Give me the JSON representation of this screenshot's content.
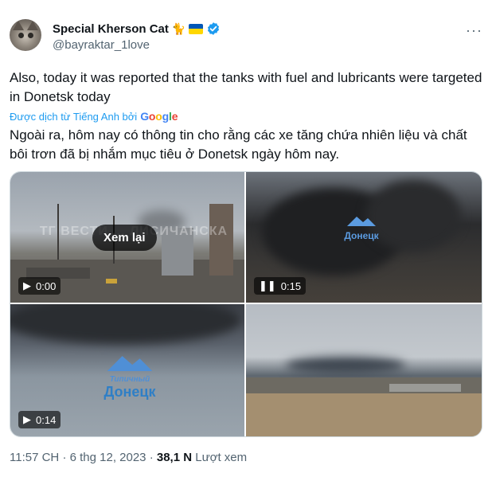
{
  "author": {
    "display_name": "Special Kherson Cat",
    "handle": "@bayraktar_1love",
    "cat_emoji": "🐈",
    "more_label": "···"
  },
  "tweet": {
    "text_original": "Also, today it was reported that the tanks with fuel and lubricants were targeted in Donetsk today",
    "translated_by_label": "Được dịch từ Tiếng Anh bởi",
    "google_label": "Google",
    "text_translated": "Ngoài ra, hôm nay có thông tin cho rằng các xe tăng chứa nhiên liệu và chất bôi trơn đã bị nhắm mục tiêu ở Donetsk ngày hôm nay."
  },
  "media": [
    {
      "type": "video",
      "state": "play",
      "time": "0:00",
      "overlay_button": "Xem lại",
      "watermark": "ТГ ВЕСТИ ... ЛИСИЧАНСКА"
    },
    {
      "type": "video",
      "state": "pause",
      "time": "0:15",
      "watermark": "Донецк"
    },
    {
      "type": "video",
      "state": "play",
      "time": "0:14",
      "watermark_top": "Типичный",
      "watermark": "Донецк"
    },
    {
      "type": "image"
    }
  ],
  "footer": {
    "time": "11:57 CH",
    "date": "6 thg 12, 2023",
    "separator": "·",
    "views_count": "38,1 N",
    "views_label": "Lượt xem"
  },
  "colors": {
    "link": "#1d9bf0",
    "secondary_text": "#536471",
    "verified": "#1d9bf0",
    "flag_blue": "#0057b7",
    "flag_yellow": "#ffd700"
  }
}
